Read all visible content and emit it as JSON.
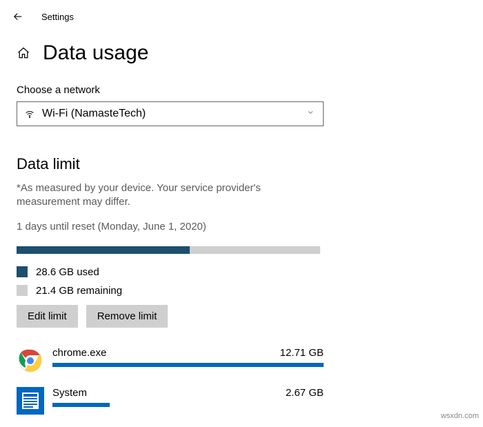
{
  "topbar": {
    "title": "Settings"
  },
  "page": {
    "title": "Data usage"
  },
  "network": {
    "label": "Choose a network",
    "selected": "Wi-Fi (NamasteTech)"
  },
  "dataLimit": {
    "heading": "Data limit",
    "disclaimer": "*As measured by your device. Your service provider's measurement may differ.",
    "resetInfo": "1 days until reset (Monday, June 1, 2020)",
    "barPercent": 57,
    "used": "28.6 GB used",
    "remaining": "21.4 GB remaining",
    "editBtn": "Edit limit",
    "removeBtn": "Remove limit"
  },
  "apps": [
    {
      "name": "chrome.exe",
      "usage": "12.71 GB",
      "barPercent": 100
    },
    {
      "name": "System",
      "usage": "2.67 GB",
      "barPercent": 21
    }
  ],
  "watermark": "wsxdn.com"
}
